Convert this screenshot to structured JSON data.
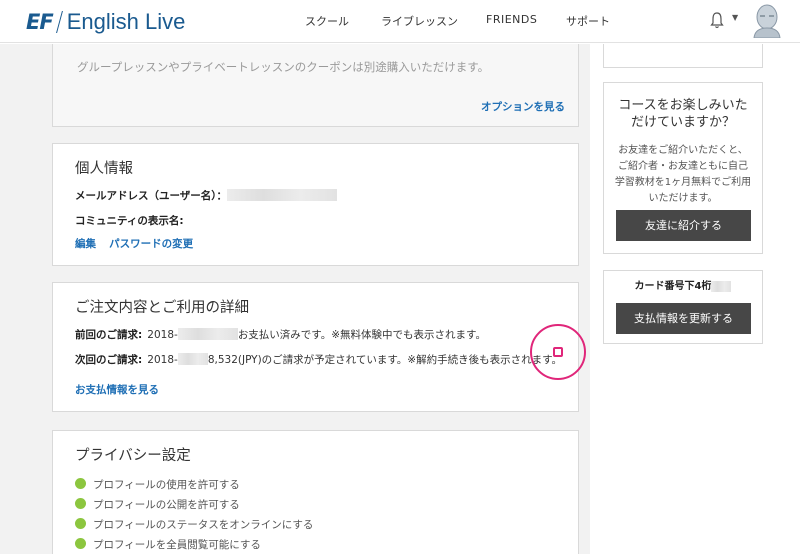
{
  "header": {
    "logo_ef": "EF",
    "logo_text": "English Live",
    "nav": [
      "スクール",
      "ライブレッスン",
      "FRIENDS",
      "サポート"
    ]
  },
  "coupon_card": {
    "note": "グループレッスンやプライベートレッスンのクーポンは別途購入いただけます。",
    "link": "オプションを見る"
  },
  "personal": {
    "title": "個人情報",
    "email_label": "メールアドレス（ユーザー名）：",
    "community_label": "コミュニティの表示名:",
    "edit_link": "編集",
    "password_link": "パスワードの変更"
  },
  "order": {
    "title": "ご注文内容とご利用の詳細",
    "prev_label": "前回のご請求:",
    "prev_date": "2018-",
    "prev_text": "お支払い済みです。※無料体験中でも表示されます。",
    "next_label": "次回のご請求:",
    "next_date": "2018-",
    "next_text": "8,532(JPY)のご請求が予定されています。※解約手続き後も表示されます。",
    "link": "お支払情報を見る"
  },
  "privacy": {
    "title": "プライバシー設定",
    "items": [
      "プロフィールの使用を許可する",
      "プロフィールの公開を許可する",
      "プロフィールのステータスをオンラインにする",
      "プロフィールを全員閲覧可能にする"
    ],
    "status_color": "#8cc63f"
  },
  "referral": {
    "heading": "コースをお楽しみいただけていますか？",
    "body": "お友達をご紹介いただくと、ご紹介者・お友達ともに自己学習教材を1ヶ月無料でご利用いただけます。",
    "button": "友達に紹介する"
  },
  "card_info": {
    "label": "カード番号下4桁",
    "button": "支払情報を更新する"
  },
  "colors": {
    "brand": "#1a5a8f",
    "link": "#1f6fb5",
    "annotation": "#e0267a",
    "button_bg": "#474747"
  }
}
